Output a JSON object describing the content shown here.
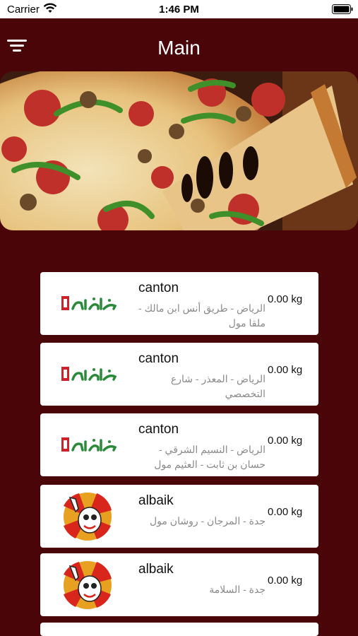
{
  "status_bar": {
    "carrier": "Carrier",
    "time": "1:46 PM"
  },
  "nav": {
    "title": "Main",
    "menu_icon": "filter-lines-icon"
  },
  "hero": {
    "image": "pizza-photo"
  },
  "restaurants": [
    {
      "name": "canton",
      "address": "الرياض - طريق أنس ابن مالك - ملقا مول",
      "weight": "0.00 kg",
      "logo": "canton"
    },
    {
      "name": "canton",
      "address": "الرياض - المعذر - شارع التخصصي",
      "weight": "0.00 kg",
      "logo": "canton"
    },
    {
      "name": "canton",
      "address": "الرياض - النسيم الشرقي - حسان بن ثابت - العثيم مول",
      "weight": "0.00 kg",
      "logo": "canton"
    },
    {
      "name": "albaik",
      "address": "جدة - المرجان - روشان مول",
      "weight": "0.00 kg",
      "logo": "albaik"
    },
    {
      "name": "albaik",
      "address": "جدة - السلامة",
      "weight": "0.00 kg",
      "logo": "albaik"
    }
  ],
  "colors": {
    "background": "#4a0508",
    "card": "#ffffff",
    "subtitle": "#8a8a8a"
  }
}
